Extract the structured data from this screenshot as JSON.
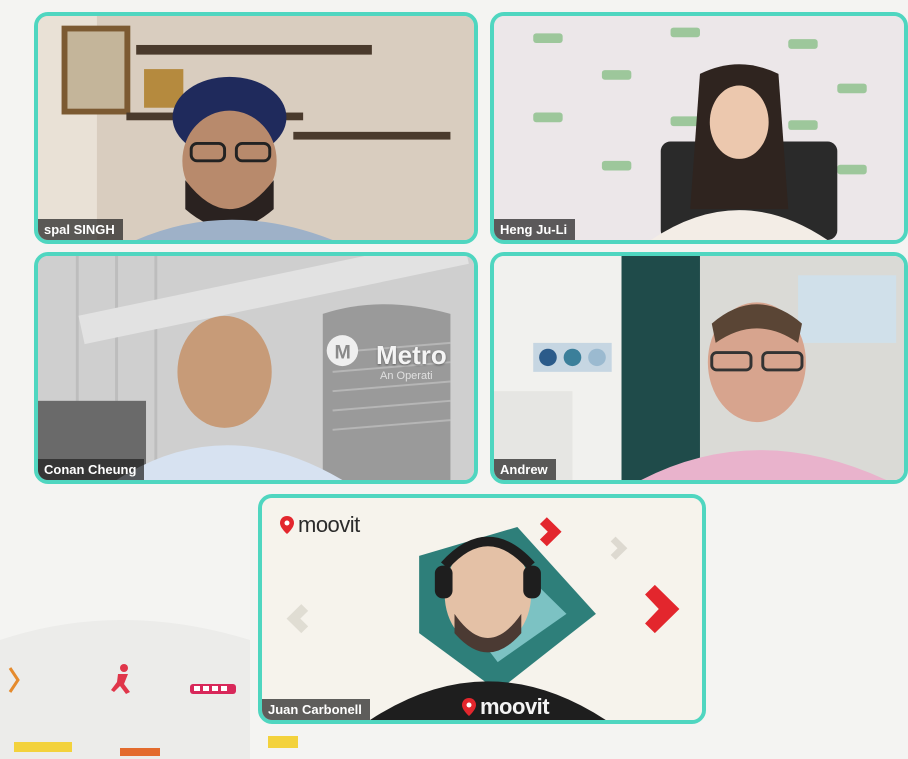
{
  "participants": [
    {
      "name": "spal SINGH"
    },
    {
      "name": "Heng Ju-Li"
    },
    {
      "name": "Conan Cheung"
    },
    {
      "name": "Andrew"
    },
    {
      "name": "Juan Carbonell"
    }
  ],
  "backgrounds": {
    "metro_logo": "Metro",
    "metro_sub": "An Operati",
    "moovit_logo": "moovit",
    "shirt_logo": "moovit"
  },
  "colors": {
    "tile_border": "#4fd6c0",
    "moovit_red": "#e3262d",
    "name_tag_bg": "#232323"
  }
}
